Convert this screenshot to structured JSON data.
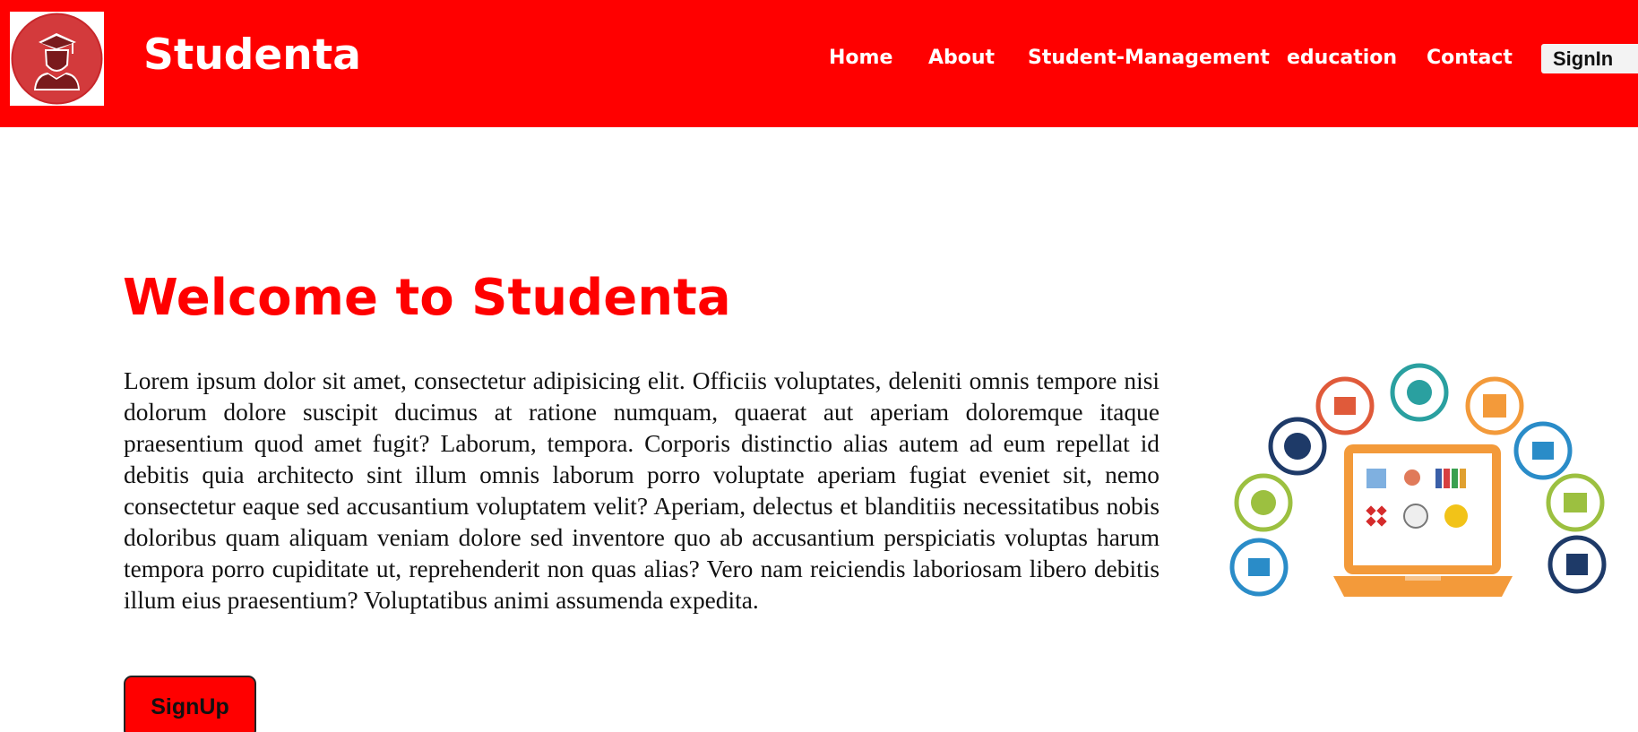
{
  "header": {
    "brand": "Studenta",
    "logo_icon": "graduate-student-icon",
    "nav": [
      {
        "label": "Home"
      },
      {
        "label": "About"
      },
      {
        "label": "Student-Management"
      },
      {
        "label": "education"
      },
      {
        "label": "Contact"
      }
    ],
    "signin_label": "SignIn"
  },
  "main": {
    "title": "Welcome to Studenta",
    "paragraph": "Lorem ipsum dolor sit amet, consectetur adipisicing elit. Officiis voluptates, deleniti omnis tempore nisi dolorum dolore suscipit ducimus at ratione numquam, quaerat aut aperiam doloremque itaque praesentium quod amet fugit? Laborum, tempora. Corporis distinctio alias autem ad eum repellat id debitis quia architecto sint illum omnis laborum porro voluptate aperiam fugiat eveniet sit, nemo consectetur eaque sed accusantium voluptatem velit? Aperiam, delectus et blanditiis necessitatibus nobis doloribus quam aliquam veniam dolore sed inventore quo ab accusantium perspiciatis voluptas harum tempora porro cupiditate ut, reprehenderit non quas alias? Vero nam reiciendis laboriosam libero debitis illum eius praesentium? Voluptatibus animi assumenda expedita.",
    "signup_label": "SignUp",
    "illustration_icon": "student-management-laptop-illustration"
  },
  "colors": {
    "brand_red": "#ff0000",
    "header_text": "#ffffff",
    "body_text": "#111111"
  }
}
